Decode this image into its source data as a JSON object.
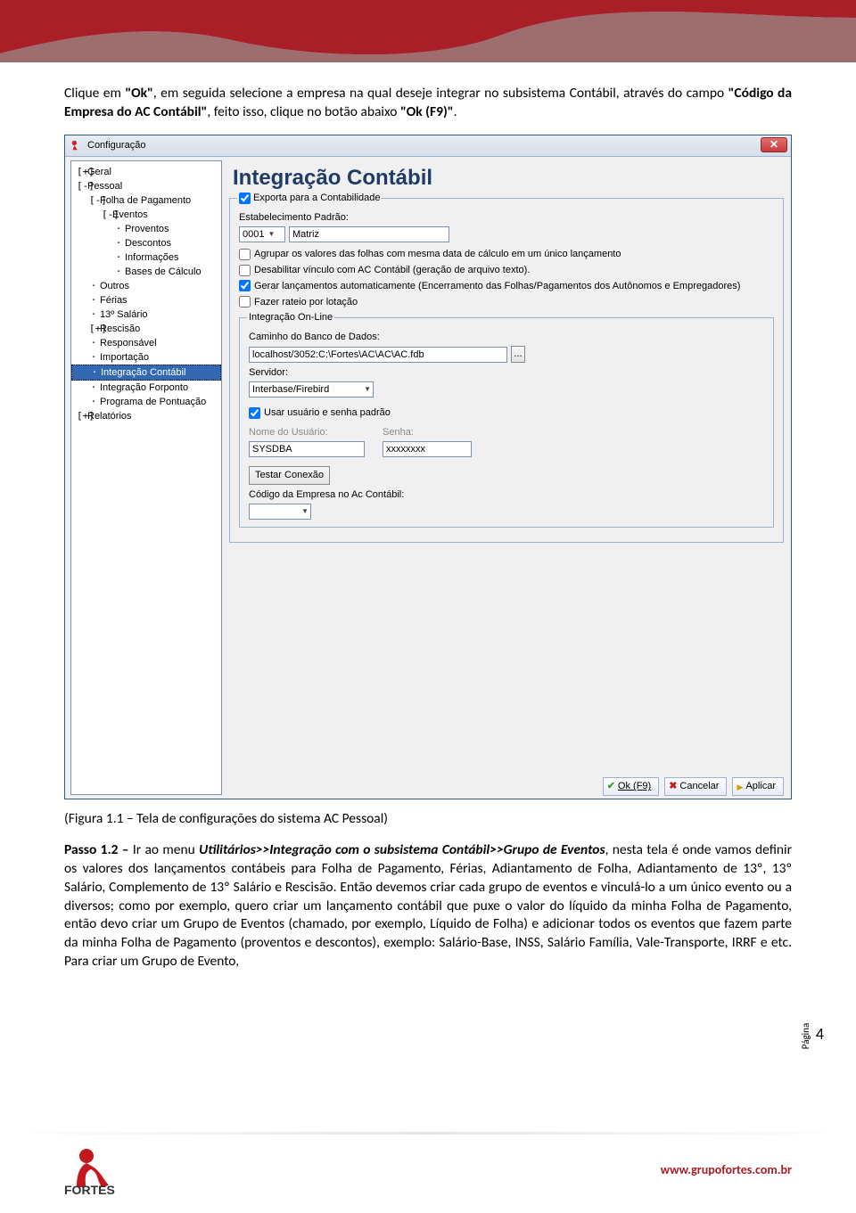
{
  "doc": {
    "para1_pre": "Clique em ",
    "para1_b1": "\"Ok\"",
    "para1_mid1": ", em seguida selecione a empresa na qual deseje integrar no subsistema Contábil, através do campo ",
    "para1_b2": "\"Código da Empresa do AC Contábil\"",
    "para1_mid2": ", feito isso, clique no botão abaixo ",
    "para1_b3": "\"Ok (F9)\"",
    "para1_end": ".",
    "caption": "(Figura 1.1 – Tela de configurações do sistema AC Pessoal)",
    "p2_label": "Passo 1.2 – ",
    "p2_mid1": "Ir ao menu ",
    "p2_i": "Utilitários>>Integração com o subsistema Contábil>>Grupo de Eventos",
    "p2_rest": ", nesta tela é onde vamos definir os valores dos lançamentos contábeis para Folha de Pagamento, Férias, Adiantamento de Folha, Adiantamento de 13º, 13º Salário, Complemento de 13º Salário e Rescisão. Então devemos criar cada grupo de eventos e vinculá-lo a um único evento ou a diversos; como por exemplo, quero criar um lançamento contábil que puxe o valor do líquido da minha Folha de Pagamento, então devo criar um Grupo de Eventos (chamado, por exemplo, Líquido de Folha) e adicionar todos os eventos que fazem parte da minha Folha de Pagamento (proventos e descontos), exemplo: Salário-Base, INSS, Salário Família, Vale-Transporte, IRRF e etc. Para criar um Grupo de Evento,"
  },
  "win": {
    "title": "Configuração",
    "panel_title": "Integração Contábil",
    "tree": [
      {
        "l": 0,
        "t": "+",
        "txt": "Geral"
      },
      {
        "l": 0,
        "t": "-",
        "txt": "Pessoal"
      },
      {
        "l": 1,
        "t": "-",
        "txt": "Folha de Pagamento"
      },
      {
        "l": 2,
        "t": "-",
        "txt": "Eventos"
      },
      {
        "l": 3,
        "t": "",
        "txt": "Proventos"
      },
      {
        "l": 3,
        "t": "",
        "txt": "Descontos"
      },
      {
        "l": 3,
        "t": "",
        "txt": "Informações"
      },
      {
        "l": 3,
        "t": "",
        "txt": "Bases de Cálculo"
      },
      {
        "l": 1,
        "t": "",
        "txt": "Outros"
      },
      {
        "l": 1,
        "t": "",
        "txt": "Férias"
      },
      {
        "l": 1,
        "t": "",
        "txt": "13º Salário"
      },
      {
        "l": 1,
        "t": "+",
        "txt": "Rescisão"
      },
      {
        "l": 1,
        "t": "",
        "txt": "Responsável"
      },
      {
        "l": 1,
        "t": "",
        "txt": "Importação"
      },
      {
        "l": 1,
        "t": "",
        "txt": "Integração Contábil",
        "sel": true
      },
      {
        "l": 1,
        "t": "",
        "txt": "Integração Forponto"
      },
      {
        "l": 1,
        "t": "",
        "txt": "Programa de Pontuação"
      },
      {
        "l": 0,
        "t": "+",
        "txt": "Relatórios"
      }
    ],
    "export_group": "Exporta para a Contabilidade",
    "estab_lbl": "Estabelecimento Padrão:",
    "estab_code": "0001",
    "estab_name": "Matriz",
    "opt_agrupar": "Agrupar os valores das folhas com mesma data de cálculo em um único lançamento",
    "opt_desab": "Desabilitar vínculo com AC Contábil (geração de arquivo texto).",
    "opt_gerar": "Gerar lançamentos automaticamente (Encerramento das Folhas/Pagamentos dos Autônomos e Empregadores)",
    "opt_rateio": "Fazer rateio por lotação",
    "online_group": "Integração On-Line",
    "db_lbl": "Caminho do Banco de Dados:",
    "db_val": "localhost/3052:C:\\Fortes\\AC\\AC\\AC.fdb",
    "srv_lbl": "Servidor:",
    "srv_val": "Interbase/Firebird",
    "use_default": "Usar usuário e senha padrão",
    "user_lbl": "Nome do Usuário:",
    "user_val": "SYSDBA",
    "pass_lbl": "Senha:",
    "pass_val": "xxxxxxxx",
    "testar": "Testar Conexão",
    "codigo_ac": "Código da Empresa no Ac Contábil:",
    "btn_ok": "Ok (F9)",
    "btn_cancel": "Cancelar",
    "btn_apply": "Aplicar"
  },
  "footer": {
    "page_label": "Página",
    "page_num": "4",
    "url": "www.grupofortes.com.br",
    "brand": "FORTES"
  }
}
